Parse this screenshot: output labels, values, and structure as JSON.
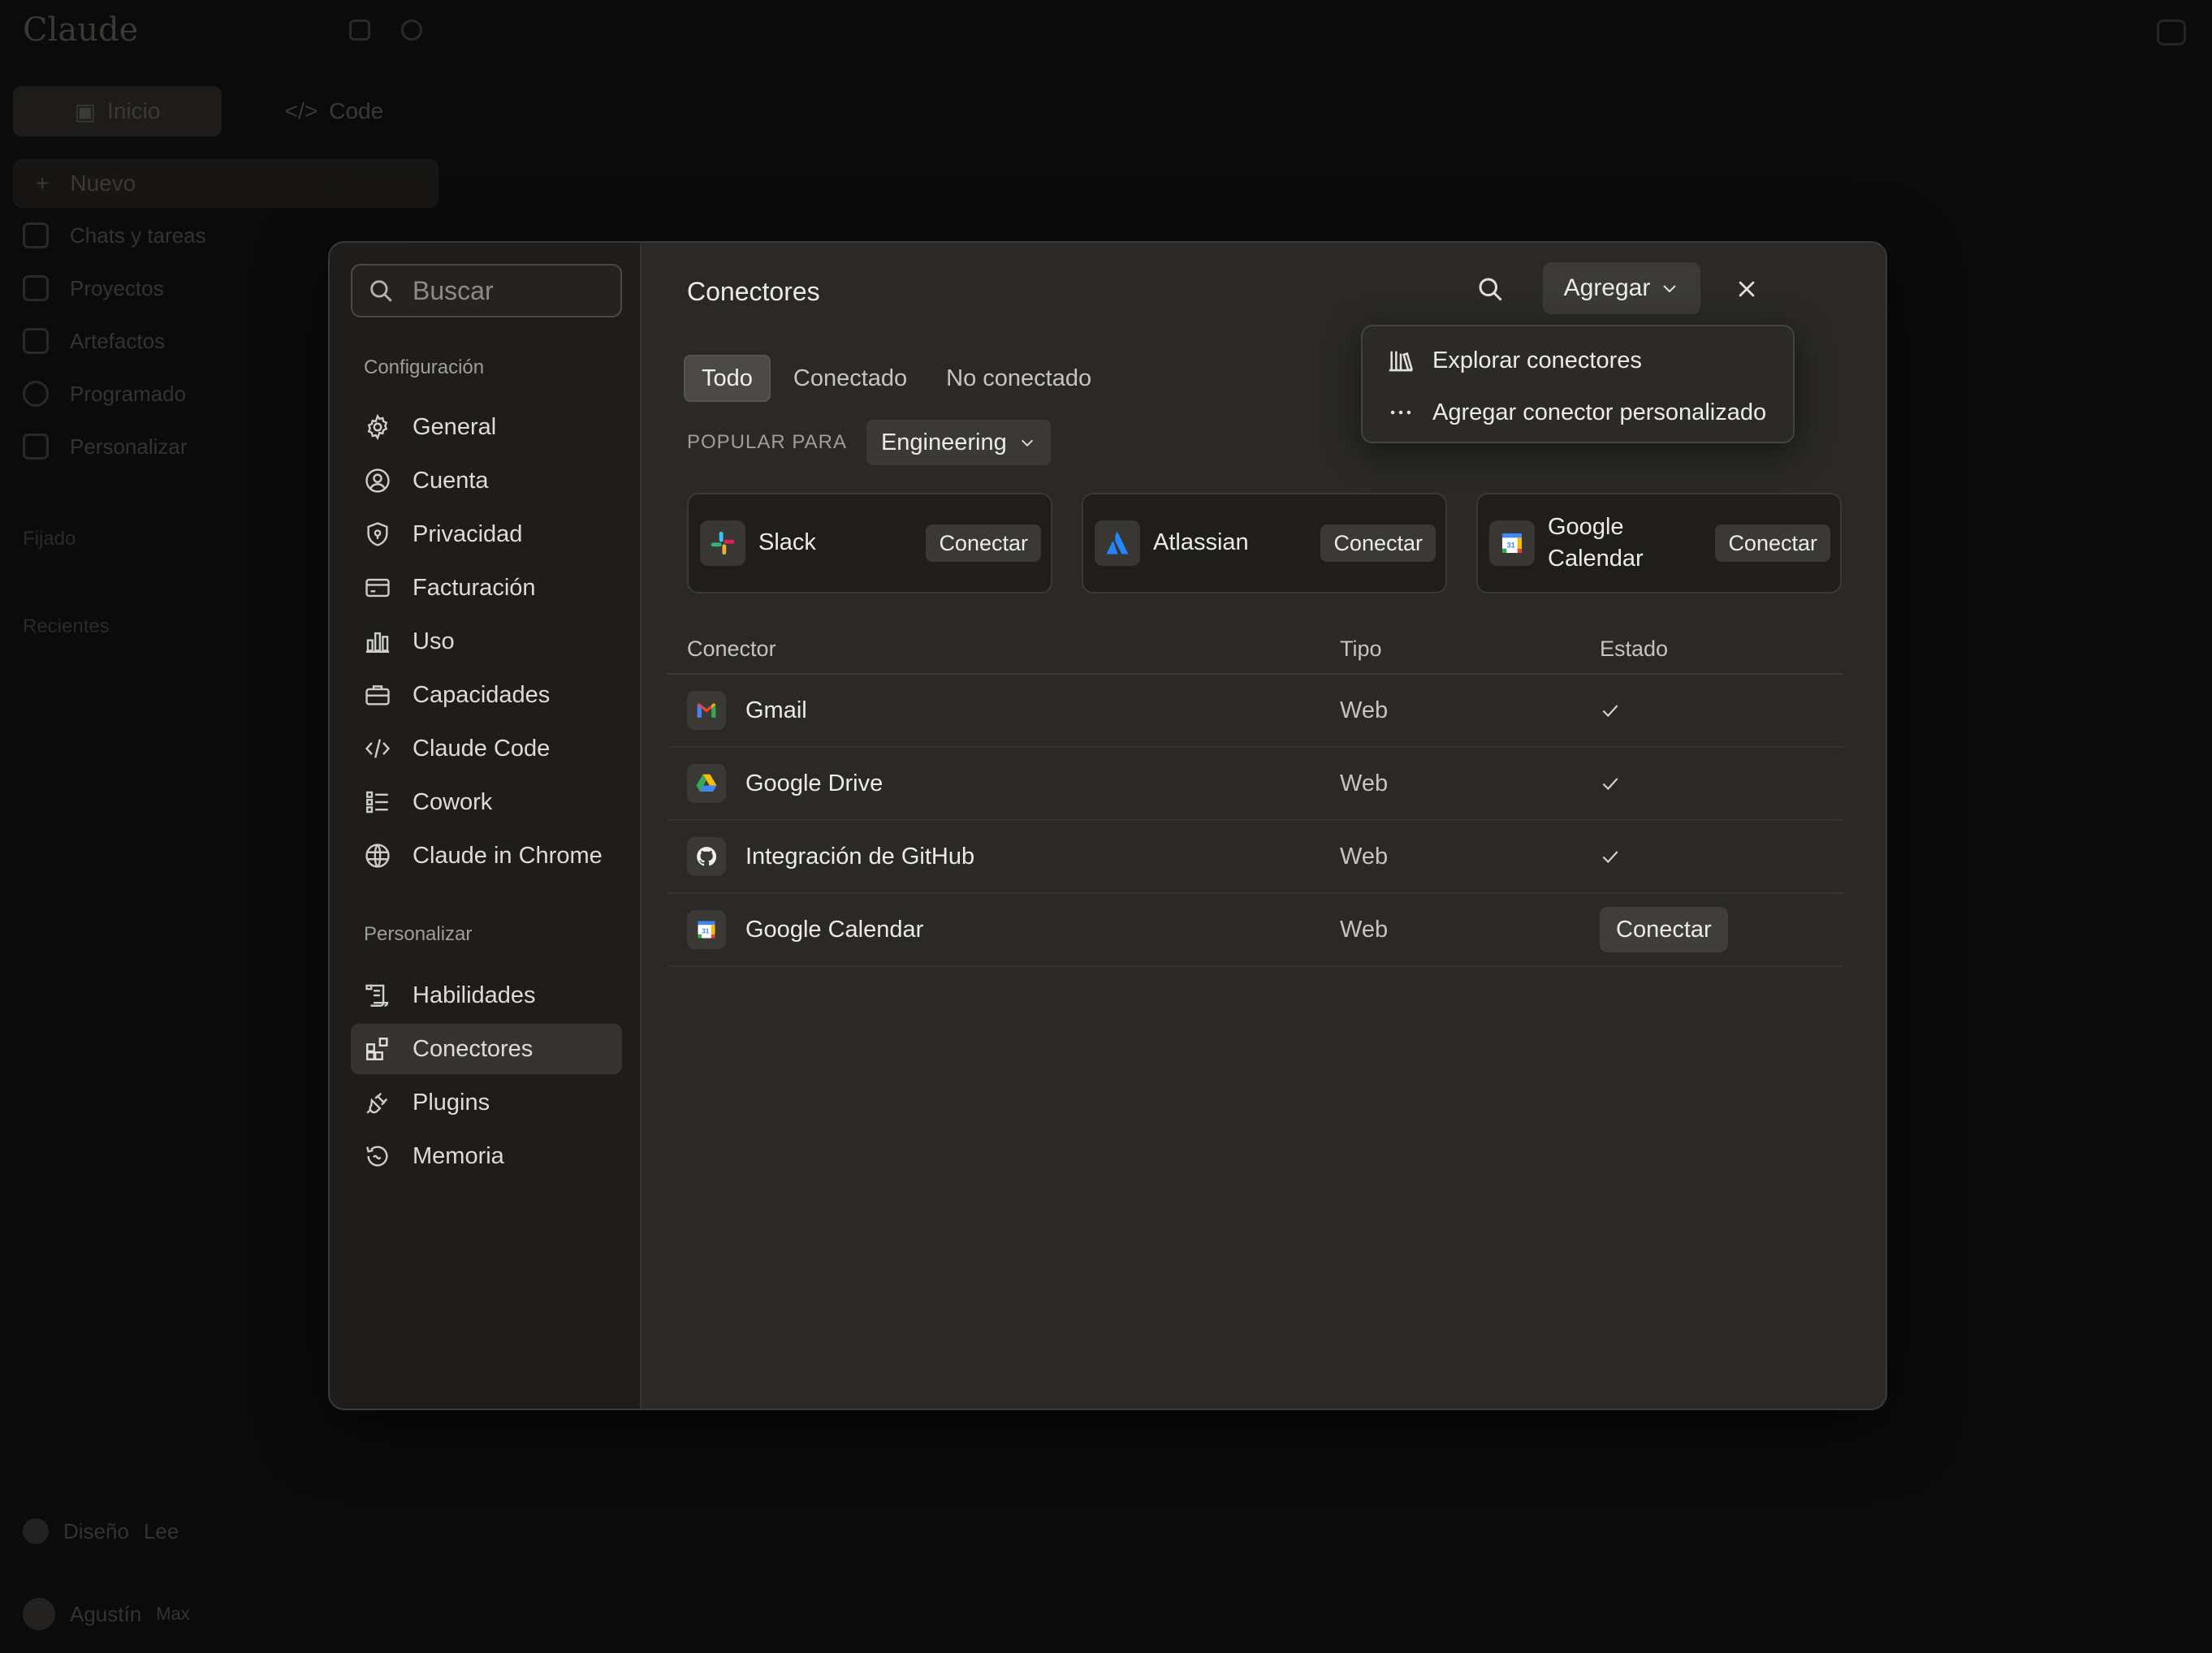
{
  "background": {
    "logo": "Claude",
    "modes": [
      "Inicio",
      "Code"
    ],
    "new_label": "Nuevo",
    "items": [
      "Chats y tareas",
      "Proyectos",
      "Artefactos",
      "Programado",
      "Personalizar"
    ],
    "sections": [
      "Fijado",
      "Recientes"
    ],
    "bottom_item": "Diseño",
    "bottom_item_badge": "Lee",
    "user_name": "Agustín",
    "user_plan": "Max"
  },
  "settings": {
    "search_placeholder": "Buscar",
    "section_config": "Configuración",
    "config_items": [
      {
        "label": "General",
        "icon": "gear-icon"
      },
      {
        "label": "Cuenta",
        "icon": "user-circle-icon"
      },
      {
        "label": "Privacidad",
        "icon": "shield-icon"
      },
      {
        "label": "Facturación",
        "icon": "credit-card-icon"
      },
      {
        "label": "Uso",
        "icon": "bar-chart-icon"
      },
      {
        "label": "Capacidades",
        "icon": "briefcase-icon"
      },
      {
        "label": "Claude Code",
        "icon": "code-icon"
      },
      {
        "label": "Cowork",
        "icon": "checklist-icon"
      },
      {
        "label": "Claude in Chrome",
        "icon": "globe-icon"
      }
    ],
    "section_personalize": "Personalizar",
    "personalize_items": [
      {
        "label": "Habilidades",
        "icon": "scroll-icon"
      },
      {
        "label": "Conectores",
        "icon": "connectors-icon",
        "active": true
      },
      {
        "label": "Plugins",
        "icon": "plug-icon"
      },
      {
        "label": "Memoria",
        "icon": "memory-icon"
      }
    ]
  },
  "connectors": {
    "title": "Conectores",
    "add_label": "Agregar",
    "tabs": [
      "Todo",
      "Conectado",
      "No conectado"
    ],
    "active_tab": "Todo",
    "popular_label": "POPULAR PARA",
    "popular_value": "Engineering",
    "cards": [
      {
        "name": "Slack",
        "button": "Conectar"
      },
      {
        "name": "Atlassian",
        "button": "Conectar"
      },
      {
        "name": "Google Calendar",
        "button": "Conectar"
      }
    ],
    "table": {
      "headers": [
        "Conector",
        "Tipo",
        "Estado"
      ],
      "rows": [
        {
          "name": "Gmail",
          "type": "Web",
          "status": "connected"
        },
        {
          "name": "Google Drive",
          "type": "Web",
          "status": "connected"
        },
        {
          "name": "Integración de GitHub",
          "type": "Web",
          "status": "connected"
        },
        {
          "name": "Google Calendar",
          "type": "Web",
          "status": "Conectar"
        }
      ]
    },
    "dropdown": [
      {
        "label": "Explorar conectores",
        "icon": "library-icon"
      },
      {
        "label": "Agregar conector personalizado",
        "icon": "more-horizontal-icon"
      }
    ]
  },
  "colors": {
    "background": "#0a0a0a",
    "modal_main": "#2a2927",
    "modal_sidebar": "#1e1d1b",
    "accent_text": "#ecebe6"
  }
}
